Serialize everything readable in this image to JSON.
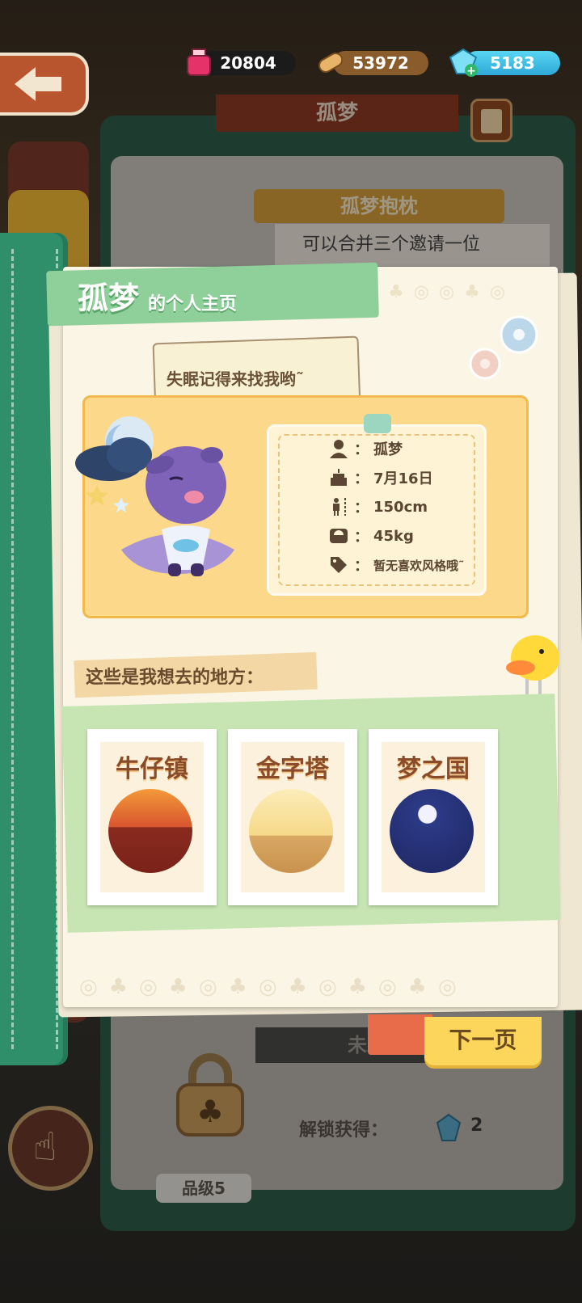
{
  "currencies": {
    "ink": {
      "value": "20804",
      "icon": "ink-bottle-icon",
      "color": "#e5336a"
    },
    "wood": {
      "value": "53972",
      "icon": "wood-log-icon",
      "color": "#8a5c2c"
    },
    "gem": {
      "value": "5183",
      "icon": "gem-plus-icon",
      "color": "#3fc0e6"
    }
  },
  "underlying": {
    "title": "孤梦",
    "item_name": "孤梦抱枕",
    "item_desc": "可以合并三个邀请一位",
    "undiscovered": "未发现",
    "unlock_label": "解锁获得：",
    "unlock_gem_count": "2",
    "grade": "品级5"
  },
  "profile": {
    "name": "孤梦",
    "title_suffix": "的个人主页",
    "speech": "失眠记得来找我哟˜",
    "info": [
      {
        "icon": "person-icon",
        "value": "孤梦"
      },
      {
        "icon": "birthday-cake-icon",
        "value": "7月16日"
      },
      {
        "icon": "height-icon",
        "value": "150cm"
      },
      {
        "icon": "scale-icon",
        "value": "45kg"
      },
      {
        "icon": "tag-icon",
        "value": "暂无喜欢风格哦˜"
      }
    ],
    "info_colon": "：",
    "places_label": "这些是我想去的地方：",
    "places": [
      {
        "name": "牛仔镇",
        "icon": "cowboy-town-sunset-icon"
      },
      {
        "name": "金字塔",
        "icon": "pyramid-desert-icon"
      },
      {
        "name": "梦之国",
        "icon": "dreamland-moon-icon"
      }
    ]
  },
  "next_page_label": "下一页",
  "colors": {
    "accent_green": "#8fd09a",
    "card_yellow": "#fcd88a",
    "button_yellow": "#fcd65a",
    "book_green": "#2f8f6a"
  }
}
